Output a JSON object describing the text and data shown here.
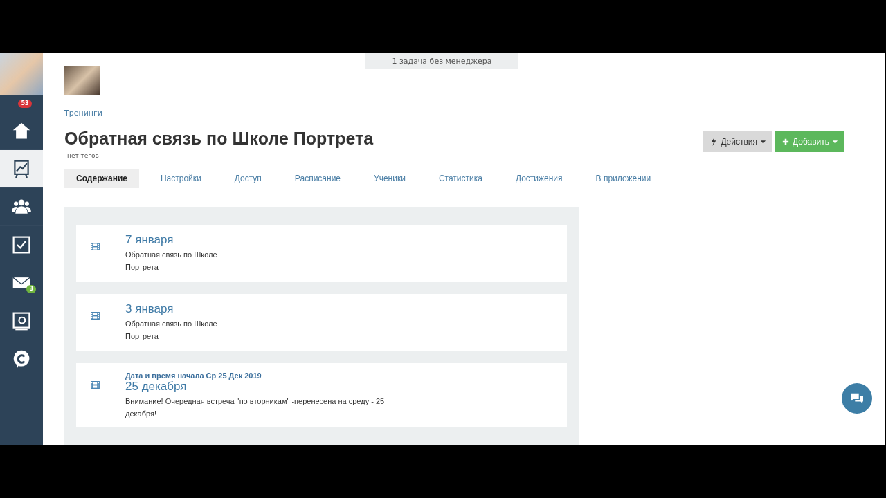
{
  "sidebar": {
    "notification_badge": "53",
    "items": [
      {
        "kind": "home",
        "selected": false
      },
      {
        "kind": "chart",
        "selected": true
      },
      {
        "kind": "users",
        "selected": false
      },
      {
        "kind": "tasks",
        "selected": false
      },
      {
        "kind": "mail",
        "selected": false,
        "badge": "3"
      },
      {
        "kind": "safe",
        "selected": false
      },
      {
        "kind": "chat",
        "selected": false
      }
    ]
  },
  "notice": "1 задача без менеджера",
  "breadcrumb": "Тренинги",
  "title": "Обратная связь по Школе Портрета",
  "tags": "нет тегов",
  "buttons": [
    {
      "kind": "actions",
      "label": "Действия"
    },
    {
      "kind": "add",
      "label": "Добавить"
    }
  ],
  "tabs": [
    {
      "label": "Содержание",
      "selected": true
    },
    {
      "label": "Настройки",
      "selected": false
    },
    {
      "label": "Доступ",
      "selected": false
    },
    {
      "label": "Расписание",
      "selected": false
    },
    {
      "label": "Ученики",
      "selected": false
    },
    {
      "label": "Статистика",
      "selected": false
    },
    {
      "label": "Достижения",
      "selected": false
    },
    {
      "label": "В приложении",
      "selected": false
    }
  ],
  "lessons": [
    {
      "title": "7 января",
      "description": "Обратная связь по Школе Портрета"
    },
    {
      "title": "3 января",
      "description": "Обратная связь по Школе Портрета"
    },
    {
      "header": "Дата и время начала Ср 25 Дек 2019",
      "title": "25 декабря",
      "description": "Внимание! Очередная встреча \"по вторникам\" -перенесена на среду - 25 декабря!"
    }
  ]
}
